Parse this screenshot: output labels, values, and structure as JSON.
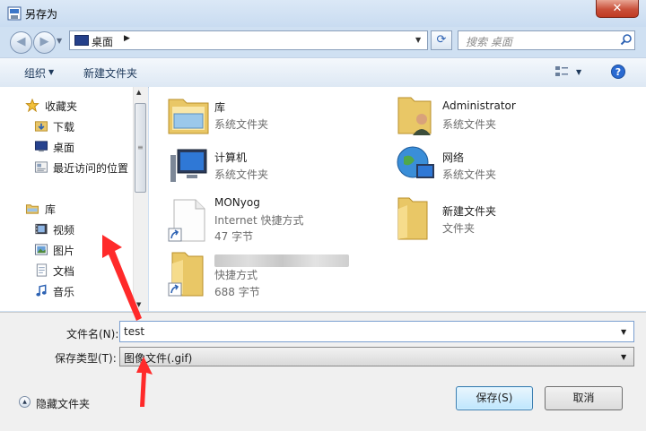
{
  "window": {
    "title": "另存为",
    "close_glyph": "✕"
  },
  "nav": {
    "back_glyph": "◀",
    "forward_glyph": "▶"
  },
  "address": {
    "location": "桌面",
    "chevron": "▶"
  },
  "search": {
    "placeholder": "搜索 桌面"
  },
  "toolbar": {
    "organize_label": "组织",
    "new_folder_label": "新建文件夹",
    "help_glyph": "?"
  },
  "sidebar": {
    "groups": [
      {
        "label": "收藏夹",
        "icon": "star-icon"
      },
      {
        "label": "库",
        "icon": "library-icon"
      }
    ],
    "items": [
      {
        "label": "下载",
        "icon": "download-folder-icon"
      },
      {
        "label": "桌面",
        "icon": "desktop-icon"
      },
      {
        "label": "最近访问的位置",
        "icon": "recent-places-icon"
      },
      {
        "label": "视频",
        "icon": "video-icon"
      },
      {
        "label": "图片",
        "icon": "pictures-icon"
      },
      {
        "label": "文档",
        "icon": "documents-icon"
      },
      {
        "label": "音乐",
        "icon": "music-icon"
      }
    ]
  },
  "files": [
    {
      "name": "库",
      "sub1": "系统文件夹",
      "icon": "library-folder-icon"
    },
    {
      "name": "Administrator",
      "sub1": "系统文件夹",
      "icon": "user-folder-icon"
    },
    {
      "name": "计算机",
      "sub1": "系统文件夹",
      "icon": "computer-icon"
    },
    {
      "name": "网络",
      "sub1": "系统文件夹",
      "icon": "network-icon"
    },
    {
      "name": "MONyog",
      "sub1": "Internet 快捷方式",
      "sub2": "47 字节",
      "icon": "internet-shortcut-icon"
    },
    {
      "name": "新建文件夹",
      "sub1": "文件夹",
      "icon": "folder-icon"
    },
    {
      "name": "",
      "sub1": "快捷方式",
      "sub2": "688 字节",
      "icon": "shortcut-folder-icon"
    }
  ],
  "form": {
    "filename_label": "文件名(N):",
    "filename_value": "test",
    "filetype_label": "保存类型(T):",
    "filetype_value": "图像文件(.gif)",
    "hide_folders_label": "隐藏文件夹",
    "save_label": "保存(S)",
    "cancel_label": "取消"
  },
  "colors": {
    "accent": "#2a6ad1",
    "annotation_arrow": "#ff2a2a"
  }
}
